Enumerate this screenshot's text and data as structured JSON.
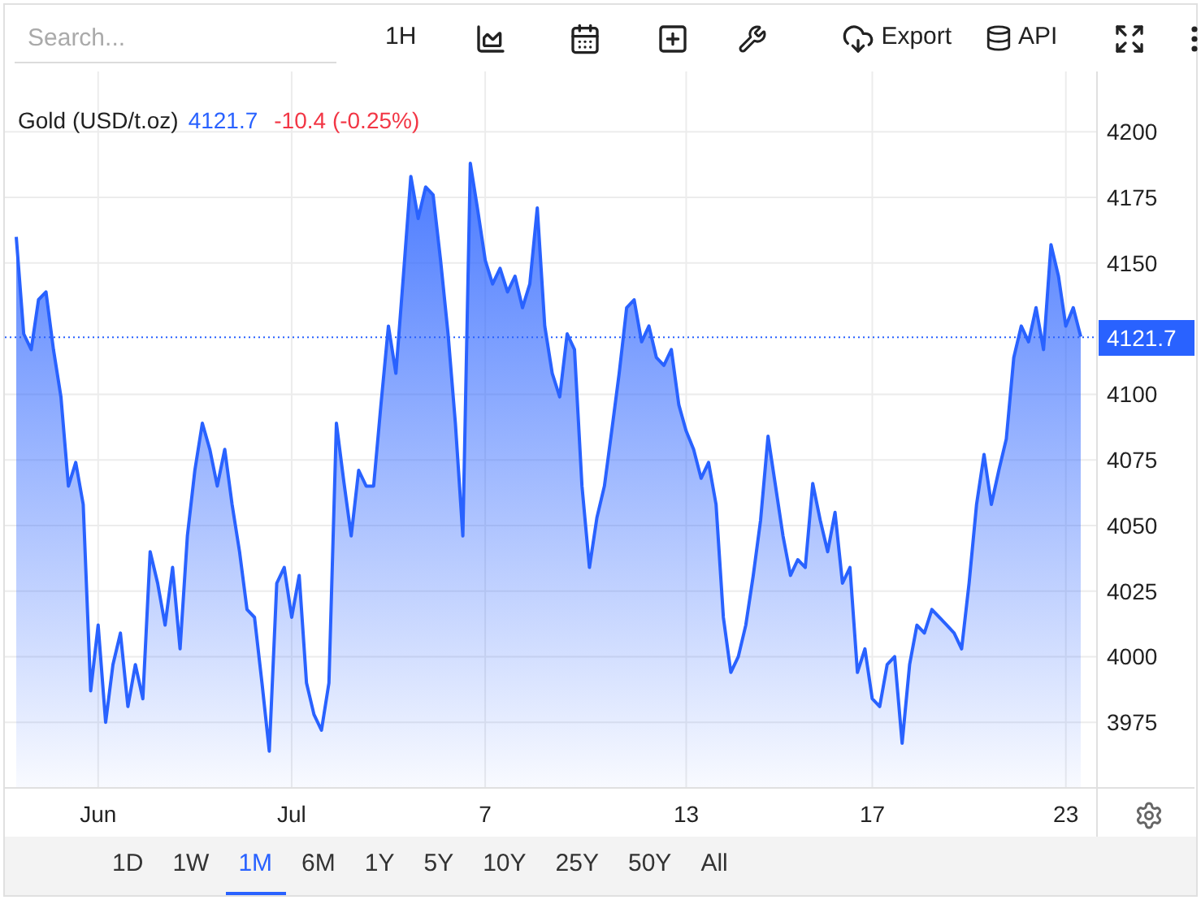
{
  "search": {
    "placeholder": "Search..."
  },
  "toolbar": {
    "interval": "1H",
    "export": "Export",
    "api": "API"
  },
  "legend": {
    "price": "4121.7",
    "change": "-10.4 (-0.25%)"
  },
  "chart_data": {
    "type": "area",
    "grid": true,
    "ylim": [
      3950,
      4223
    ],
    "yticks": [
      3975,
      4000,
      4025,
      4050,
      4075,
      4100,
      4150,
      4175,
      4200
    ],
    "ref_lines": [
      {
        "axis": "y",
        "value": 4121.7,
        "label": "4121.7",
        "color": "#2962ff"
      }
    ],
    "categories": [
      null,
      null,
      null,
      null,
      null,
      null,
      null,
      null,
      null,
      null,
      null,
      "Jun",
      null,
      null,
      null,
      null,
      null,
      null,
      null,
      null,
      null,
      null,
      null,
      null,
      null,
      null,
      null,
      null,
      null,
      null,
      null,
      null,
      null,
      null,
      null,
      null,
      null,
      "Jul",
      null,
      null,
      null,
      null,
      null,
      null,
      null,
      null,
      null,
      null,
      null,
      null,
      null,
      null,
      null,
      null,
      null,
      null,
      null,
      null,
      null,
      null,
      null,
      null,
      null,
      "7",
      null,
      null,
      null,
      null,
      null,
      null,
      null,
      null,
      null,
      null,
      null,
      null,
      null,
      null,
      null,
      null,
      null,
      null,
      null,
      null,
      null,
      null,
      null,
      null,
      null,
      null,
      "13",
      null,
      null,
      null,
      null,
      null,
      null,
      null,
      null,
      null,
      null,
      null,
      null,
      null,
      null,
      null,
      null,
      null,
      null,
      null,
      null,
      null,
      null,
      null,
      null,
      "17",
      null,
      null,
      null,
      null,
      null,
      null,
      null,
      null,
      null,
      null,
      null,
      null,
      null,
      null,
      null,
      null,
      null,
      null,
      null,
      null,
      null,
      null,
      null,
      null,
      null,
      "23",
      null,
      null
    ],
    "series": [
      {
        "name": "Gold (USD/t.oz)",
        "color": "#2962ff",
        "values": [
          4160,
          4123,
          4117,
          4136,
          4139,
          4117,
          4099,
          4065,
          4074,
          4058,
          3987,
          4012,
          3975,
          3997,
          4009,
          3981,
          3997,
          3984,
          4040,
          4028,
          4012,
          4034,
          4003,
          4046,
          4071,
          4089,
          4079,
          4065,
          4079,
          4058,
          4040,
          4018,
          4015,
          3990,
          3964,
          4028,
          4034,
          4015,
          4031,
          3990,
          3978,
          3972,
          3990,
          4089,
          4067,
          4046,
          4071,
          4065,
          4065,
          4096,
          4126,
          4108,
          4145,
          4183,
          4167,
          4179,
          4176,
          4151,
          4123,
          4089,
          4046,
          4188,
          4170,
          4151,
          4142,
          4148,
          4139,
          4145,
          4133,
          4142,
          4171,
          4126,
          4108,
          4099,
          4123,
          4117,
          4065,
          4034,
          4053,
          4065,
          4086,
          4108,
          4133,
          4136,
          4120,
          4126,
          4114,
          4111,
          4117,
          4096,
          4086,
          4079,
          4068,
          4074,
          4058,
          4015,
          3994,
          4000,
          4012,
          4031,
          4052,
          4084,
          4065,
          4046,
          4031,
          4037,
          4034,
          4066,
          4052,
          4040,
          4055,
          4028,
          4034,
          3994,
          4003,
          3984,
          3981,
          3997,
          4000,
          3967,
          3997,
          4012,
          4009,
          4018,
          4015,
          4012,
          4009,
          4003,
          4028,
          4058,
          4077,
          4058,
          4071,
          4083,
          4114,
          4126,
          4120,
          4133,
          4117,
          4157,
          4145,
          4126,
          4133,
          4122
        ]
      }
    ]
  },
  "ranges": [
    {
      "label": "1D",
      "selected": false
    },
    {
      "label": "1W",
      "selected": false
    },
    {
      "label": "1M",
      "selected": true
    },
    {
      "label": "6M",
      "selected": false
    },
    {
      "label": "1Y",
      "selected": false
    },
    {
      "label": "5Y",
      "selected": false
    },
    {
      "label": "10Y",
      "selected": false
    },
    {
      "label": "25Y",
      "selected": false
    },
    {
      "label": "50Y",
      "selected": false
    },
    {
      "label": "All",
      "selected": false
    }
  ]
}
